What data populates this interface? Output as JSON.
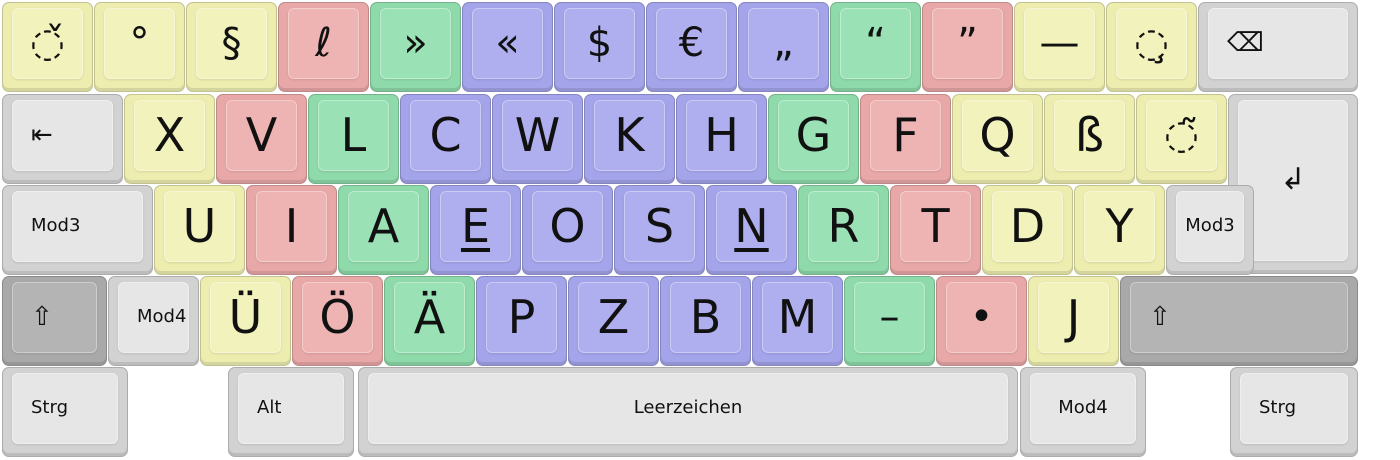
{
  "keyboard": {
    "colors": {
      "yellow": "#ededb0",
      "red": "#e8a8a8",
      "green": "#8fdaaa",
      "blue": "#a4a4ea",
      "gray": "#d2d2d2",
      "dark_gray": "#a9a9a9"
    },
    "rows": [
      [
        {
          "id": "caron",
          "label": "◌̌",
          "color": "yellow"
        },
        {
          "id": "ring",
          "label": "°",
          "color": "yellow"
        },
        {
          "id": "section",
          "label": "§",
          "color": "yellow"
        },
        {
          "id": "script-l",
          "label": "ℓ",
          "color": "red"
        },
        {
          "id": "raquo",
          "label": "»",
          "color": "green"
        },
        {
          "id": "laquo",
          "label": "«",
          "color": "blue"
        },
        {
          "id": "dollar",
          "label": "$",
          "color": "blue"
        },
        {
          "id": "euro",
          "label": "€",
          "color": "blue"
        },
        {
          "id": "low-quote",
          "label": "„",
          "color": "blue"
        },
        {
          "id": "left-quote",
          "label": "“",
          "color": "green"
        },
        {
          "id": "right-quote",
          "label": "”",
          "color": "red"
        },
        {
          "id": "em-dash",
          "label": "—",
          "color": "yellow"
        },
        {
          "id": "cedilla",
          "label": "◌̧",
          "color": "yellow"
        },
        {
          "id": "backspace",
          "label": "⌫",
          "color": "gray"
        }
      ],
      [
        {
          "id": "tab",
          "label": "⇤",
          "color": "gray"
        },
        {
          "id": "x",
          "label": "X",
          "color": "yellow"
        },
        {
          "id": "v",
          "label": "V",
          "color": "red"
        },
        {
          "id": "l",
          "label": "L",
          "color": "green"
        },
        {
          "id": "c",
          "label": "C",
          "color": "blue"
        },
        {
          "id": "w",
          "label": "W",
          "color": "blue"
        },
        {
          "id": "k",
          "label": "K",
          "color": "blue"
        },
        {
          "id": "h",
          "label": "H",
          "color": "blue"
        },
        {
          "id": "g",
          "label": "G",
          "color": "green"
        },
        {
          "id": "f",
          "label": "F",
          "color": "red"
        },
        {
          "id": "q",
          "label": "Q",
          "color": "yellow"
        },
        {
          "id": "sharp-s",
          "label": "ß",
          "color": "yellow"
        },
        {
          "id": "tilde",
          "label": "◌̃",
          "color": "yellow"
        },
        {
          "id": "enter",
          "label": "↲",
          "color": "gray"
        }
      ],
      [
        {
          "id": "mod3-left",
          "label": "Mod3",
          "color": "gray"
        },
        {
          "id": "u",
          "label": "U",
          "color": "yellow"
        },
        {
          "id": "i",
          "label": "I",
          "color": "red"
        },
        {
          "id": "a",
          "label": "A",
          "color": "green"
        },
        {
          "id": "e",
          "label": "E",
          "color": "blue",
          "homing": true
        },
        {
          "id": "o",
          "label": "O",
          "color": "blue"
        },
        {
          "id": "s",
          "label": "S",
          "color": "blue"
        },
        {
          "id": "n",
          "label": "N",
          "color": "blue",
          "homing": true
        },
        {
          "id": "r",
          "label": "R",
          "color": "green"
        },
        {
          "id": "t",
          "label": "T",
          "color": "red"
        },
        {
          "id": "d",
          "label": "D",
          "color": "yellow"
        },
        {
          "id": "y",
          "label": "Y",
          "color": "yellow"
        },
        {
          "id": "mod3-right",
          "label": "Mod3",
          "color": "gray"
        }
      ],
      [
        {
          "id": "shift-left",
          "label": "⇧",
          "color": "dark_gray"
        },
        {
          "id": "mod4-left",
          "label": "Mod4",
          "color": "gray"
        },
        {
          "id": "u-umlaut",
          "label": "Ü",
          "color": "yellow"
        },
        {
          "id": "o-umlaut",
          "label": "Ö",
          "color": "red"
        },
        {
          "id": "a-umlaut",
          "label": "Ä",
          "color": "green"
        },
        {
          "id": "p",
          "label": "P",
          "color": "blue"
        },
        {
          "id": "z",
          "label": "Z",
          "color": "blue"
        },
        {
          "id": "b",
          "label": "B",
          "color": "blue"
        },
        {
          "id": "m",
          "label": "M",
          "color": "blue"
        },
        {
          "id": "en-dash",
          "label": "–",
          "color": "green"
        },
        {
          "id": "bullet",
          "label": "•",
          "color": "red"
        },
        {
          "id": "j",
          "label": "J",
          "color": "yellow"
        },
        {
          "id": "shift-right",
          "label": "⇧",
          "color": "dark_gray"
        }
      ],
      [
        {
          "id": "ctrl-left",
          "label": "Strg",
          "color": "gray"
        },
        {
          "id": "alt",
          "label": "Alt",
          "color": "gray"
        },
        {
          "id": "space",
          "label": "Leerzeichen",
          "color": "gray"
        },
        {
          "id": "mod4-right",
          "label": "Mod4",
          "color": "gray"
        },
        {
          "id": "ctrl-right",
          "label": "Strg",
          "color": "gray"
        }
      ]
    ]
  }
}
